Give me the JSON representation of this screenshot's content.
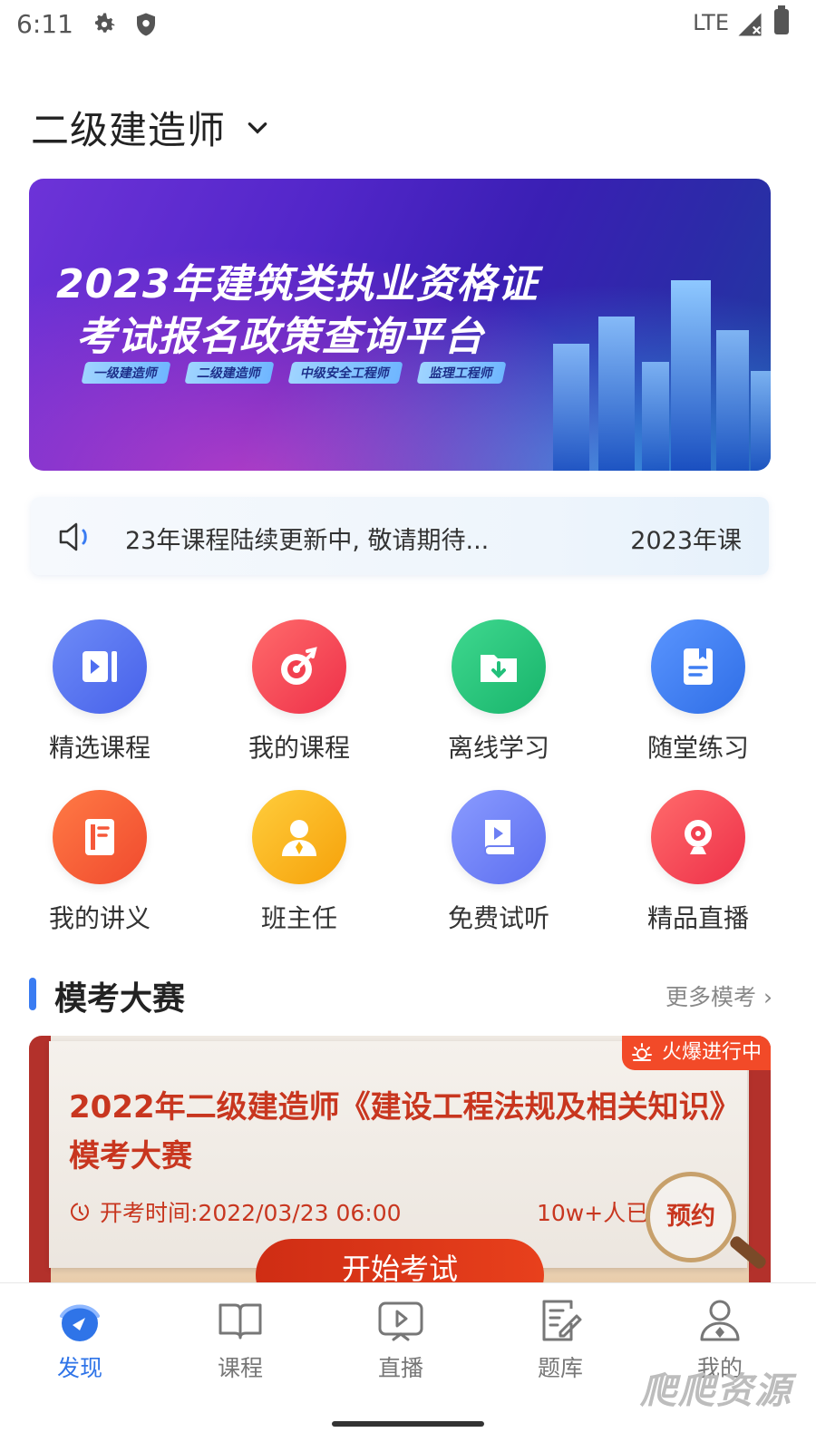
{
  "status_bar": {
    "time": "6:11",
    "network": "LTE"
  },
  "header": {
    "exam_title": "二级建造师"
  },
  "banner": {
    "line1": "2023年建筑类执业资格证",
    "line2": "考试报名政策查询平台",
    "tags": [
      "一级建造师",
      "二级建造师",
      "中级安全工程师",
      "监理工程师"
    ]
  },
  "notice": {
    "text": "23年课程陆续更新中, 敬请期待...",
    "link": "2023年课"
  },
  "grid": [
    {
      "label": "精选课程",
      "icon": "play-video-icon",
      "color": "#4f6ef0"
    },
    {
      "label": "我的课程",
      "icon": "target-icon",
      "color": "#f2404f"
    },
    {
      "label": "离线学习",
      "icon": "download-folder-icon",
      "color": "#22c07a"
    },
    {
      "label": "随堂练习",
      "icon": "notebook-icon",
      "color": "#3f7ef2"
    },
    {
      "label": "我的讲义",
      "icon": "handout-icon",
      "color": "#f5583a"
    },
    {
      "label": "班主任",
      "icon": "teacher-icon",
      "color": "#f8b20f"
    },
    {
      "label": "免费试听",
      "icon": "book-play-icon",
      "color": "#6d7ff3"
    },
    {
      "label": "精品直播",
      "icon": "webcam-icon",
      "color": "#f2404f"
    }
  ],
  "section": {
    "title": "模考大赛",
    "more": "更多模考"
  },
  "contest": {
    "badge": "火爆进行中",
    "title": "2022年二级建造师《建设工程法规及相关知识》模考大赛",
    "time": "开考时间:2022/03/23 06:00",
    "count": "10w+人已",
    "reserve": "预约",
    "start": "开始考试"
  },
  "tabbar": [
    {
      "label": "发现",
      "active": true
    },
    {
      "label": "课程",
      "active": false
    },
    {
      "label": "直播",
      "active": false
    },
    {
      "label": "题库",
      "active": false
    },
    {
      "label": "我的",
      "active": false
    }
  ],
  "watermark": "爬爬资源",
  "colors": {
    "accent": "#2f74e8",
    "contest_red": "#c8361f",
    "hot_badge": "#f24a28"
  }
}
